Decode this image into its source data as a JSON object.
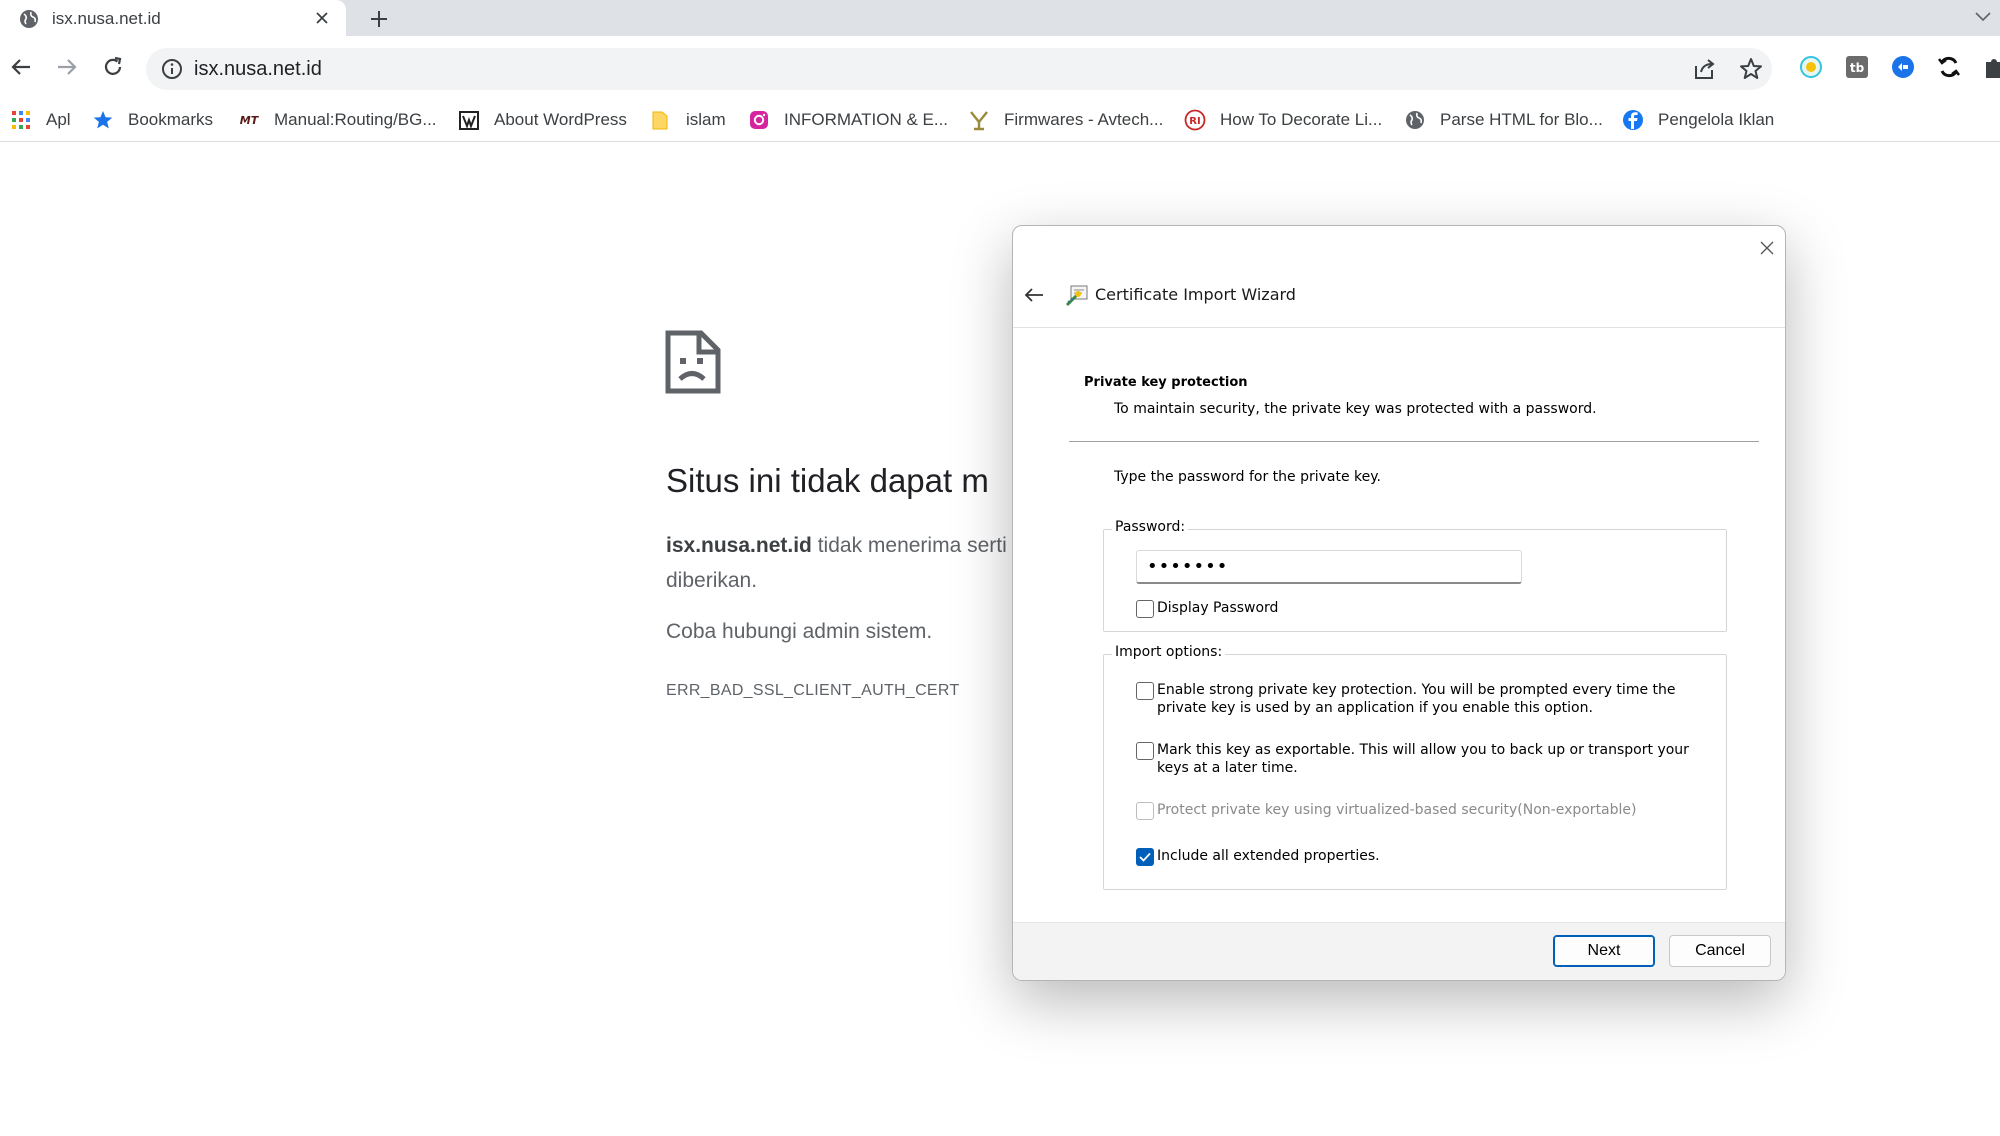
{
  "tab": {
    "title": "isx.nusa.net.id"
  },
  "omnibox": {
    "url": "isx.nusa.net.id"
  },
  "bookmarks": [
    {
      "label": "Apl",
      "icon": "apps-grid-icon"
    },
    {
      "label": "Bookmarks",
      "icon": "star-icon"
    },
    {
      "label": "Manual:Routing/BG...",
      "icon": "mikrotik-icon"
    },
    {
      "label": "About WordPress",
      "icon": "wordpress-icon"
    },
    {
      "label": "islam",
      "icon": "folder-icon"
    },
    {
      "label": "INFORMATION & E...",
      "icon": "instagram-icon"
    },
    {
      "label": "Firmwares - Avtech...",
      "icon": "avtech-icon"
    },
    {
      "label": "How To Decorate Li...",
      "icon": "ri-logo-icon"
    },
    {
      "label": "Parse HTML for Blo...",
      "icon": "globe-icon"
    },
    {
      "label": "Pengelola Iklan",
      "icon": "facebook-icon"
    }
  ],
  "error": {
    "title": "Situs ini tidak dapat m",
    "host": "isx.nusa.net.id",
    "desc_rest": " tidak menerima serti",
    "desc_line2": "diberikan.",
    "hint": "Coba hubungi admin sistem.",
    "code": "ERR_BAD_SSL_CLIENT_AUTH_CERT"
  },
  "dialog": {
    "title": "Certificate Import Wizard",
    "section_title": "Private key protection",
    "section_sub": "To maintain security, the private key was protected with a password.",
    "prompt": "Type the password for the private key.",
    "password_label": "Password:",
    "password_value": "•••••••",
    "display_password_label": "Display Password",
    "import_options_label": "Import options:",
    "options": [
      {
        "label": "Enable strong private key protection. You will be prompted every time the private key is used by an application if you enable this option.",
        "checked": false,
        "disabled": false
      },
      {
        "label": "Mark this key as exportable. This will allow you to back up or transport your keys at a later time.",
        "checked": false,
        "disabled": false
      },
      {
        "label": "Protect private key using virtualized-based security(Non-exportable)",
        "checked": false,
        "disabled": true
      },
      {
        "label": "Include all extended properties.",
        "checked": true,
        "disabled": false
      }
    ],
    "next_label": "Next",
    "cancel_label": "Cancel"
  },
  "colors": {
    "accent": "#005fb8",
    "tabstrip": "#dee1e6",
    "omnibox": "#f1f3f4"
  }
}
